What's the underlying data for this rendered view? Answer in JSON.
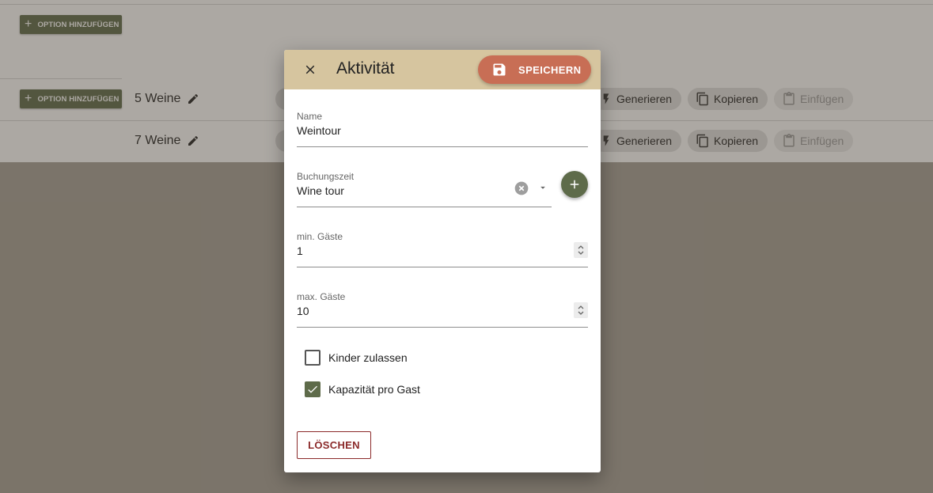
{
  "background": {
    "add_option_label": "OPTION HINZUFÜGEN",
    "groups": [
      {
        "label": "5 Weine"
      },
      {
        "label": "7 Weine"
      }
    ],
    "actions": {
      "generate": "Generieren",
      "copy": "Kopieren",
      "paste": "Einfügen"
    }
  },
  "dialog": {
    "title": "Aktivität",
    "save_label": "SPEICHERN",
    "fields": {
      "name": {
        "label": "Name",
        "value": "Weintour"
      },
      "booking_time": {
        "label": "Buchungszeit",
        "value": "Wine tour"
      },
      "min_guests": {
        "label": "min. Gäste",
        "value": "1"
      },
      "max_guests": {
        "label": "max. Gäste",
        "value": "10"
      }
    },
    "checkboxes": {
      "allow_children": {
        "label": "Kinder zulassen",
        "checked": false
      },
      "capacity_per_guest": {
        "label": "Kapazität pro Gast",
        "checked": true
      }
    },
    "delete_label": "LÖSCHEN"
  },
  "colors": {
    "header_bg": "#d6c59f",
    "save_button": "#c86e55",
    "primary_green": "#5e6b4a",
    "delete_red": "#8b2a2a"
  }
}
